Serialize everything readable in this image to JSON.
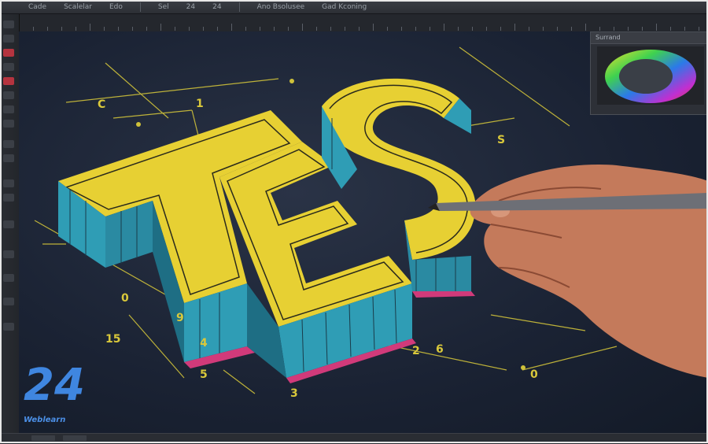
{
  "app": {
    "menu": [
      "Cade",
      "Scalelar",
      "Edo",
      "Sel",
      "24",
      "24",
      "Ano Bsolusee",
      "Gad Kconing"
    ]
  },
  "panel": {
    "title": "Surrand"
  },
  "canvas": {
    "artwork_letters": [
      "T",
      "E",
      "S"
    ],
    "dimension_labels": [
      "C",
      "1",
      "0",
      "15",
      "9",
      "4",
      "3",
      "5",
      "2",
      "6",
      "S",
      "0"
    ]
  },
  "brand": {
    "number": "24",
    "name": "Weblearn",
    "color": "#3f86e0"
  },
  "colors": {
    "letter_yellow": "#e7d033",
    "letter_cyan": "#2f9db5",
    "accent_magenta": "#d13a7a",
    "guide_yellow": "#cfc13a"
  }
}
